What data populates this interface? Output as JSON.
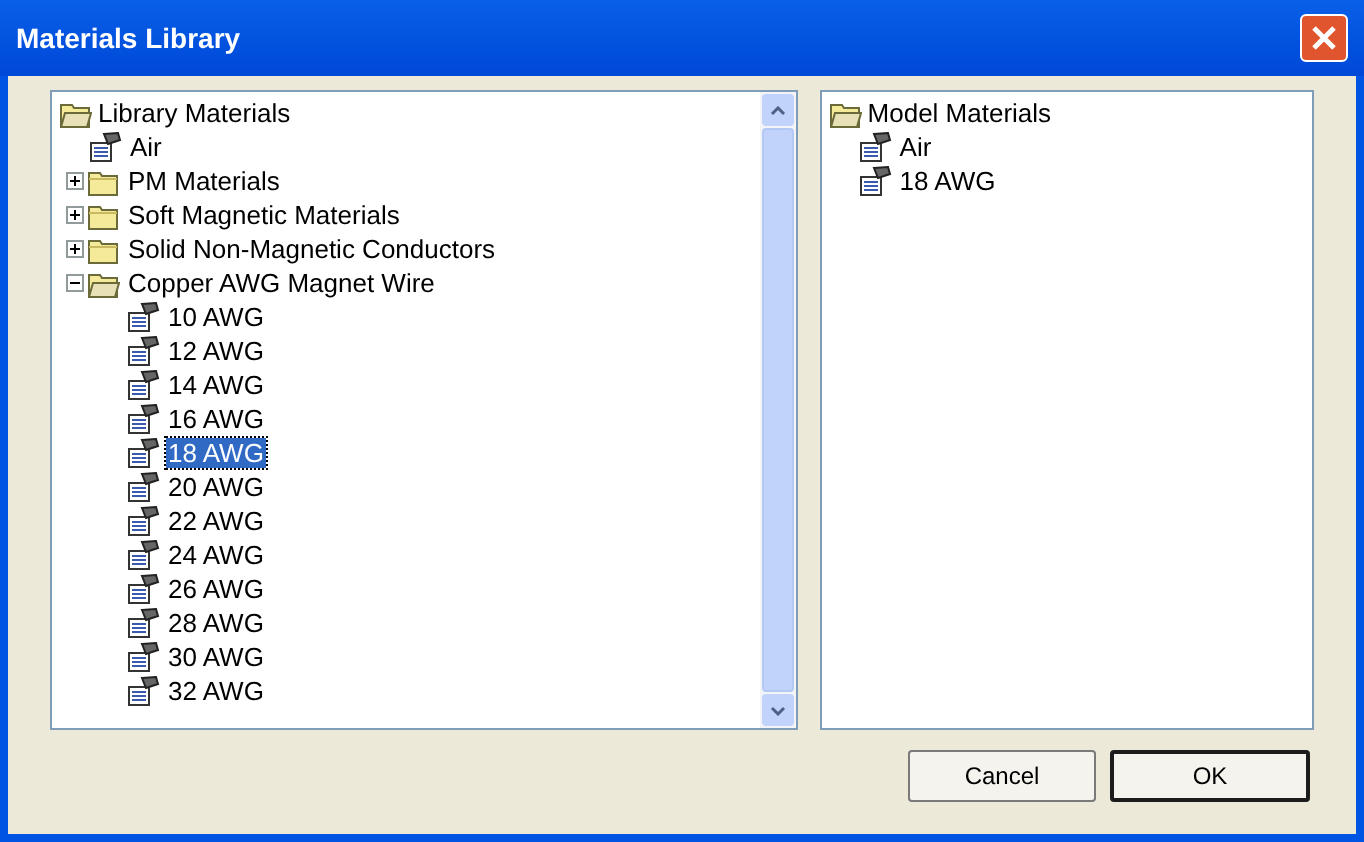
{
  "window": {
    "title": "Materials Library"
  },
  "library": {
    "label": "Library Materials",
    "expanded": true,
    "children": [
      {
        "kind": "material",
        "label": "Air",
        "selected": false
      },
      {
        "kind": "folder",
        "label": "PM Materials",
        "expanded": false
      },
      {
        "kind": "folder",
        "label": "Soft Magnetic Materials",
        "expanded": false
      },
      {
        "kind": "folder",
        "label": "Solid Non-Magnetic Conductors",
        "expanded": false
      },
      {
        "kind": "folder",
        "label": "Copper AWG Magnet Wire",
        "expanded": true,
        "children": [
          {
            "kind": "material",
            "label": "10 AWG",
            "selected": false
          },
          {
            "kind": "material",
            "label": "12 AWG",
            "selected": false
          },
          {
            "kind": "material",
            "label": "14 AWG",
            "selected": false
          },
          {
            "kind": "material",
            "label": "16 AWG",
            "selected": false
          },
          {
            "kind": "material",
            "label": "18 AWG",
            "selected": true
          },
          {
            "kind": "material",
            "label": "20 AWG",
            "selected": false
          },
          {
            "kind": "material",
            "label": "22 AWG",
            "selected": false
          },
          {
            "kind": "material",
            "label": "24 AWG",
            "selected": false
          },
          {
            "kind": "material",
            "label": "26 AWG",
            "selected": false
          },
          {
            "kind": "material",
            "label": "28 AWG",
            "selected": false
          },
          {
            "kind": "material",
            "label": "30 AWG",
            "selected": false
          },
          {
            "kind": "material",
            "label": "32 AWG",
            "selected": false
          }
        ]
      }
    ]
  },
  "model": {
    "label": "Model Materials",
    "expanded": true,
    "children": [
      {
        "kind": "material",
        "label": "Air",
        "selected": false
      },
      {
        "kind": "material",
        "label": "18 AWG",
        "selected": false
      }
    ]
  },
  "buttons": [
    {
      "label": "Cancel",
      "default": false
    },
    {
      "label": "OK",
      "default": true
    }
  ]
}
